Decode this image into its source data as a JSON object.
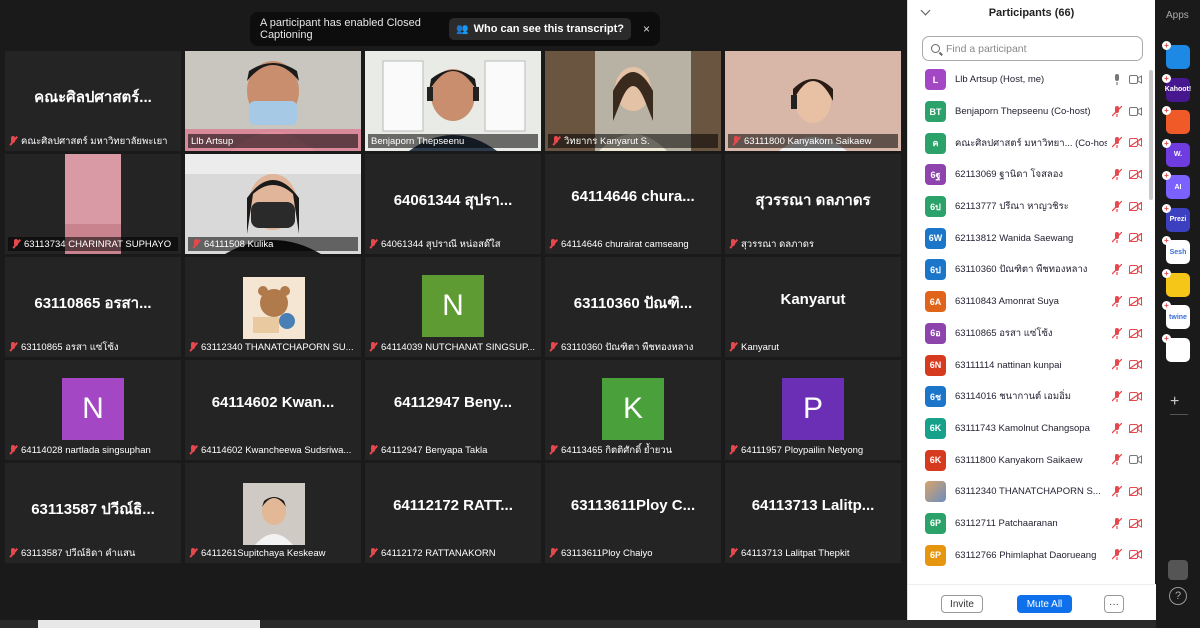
{
  "caption_bar": {
    "message": "A participant has enabled Closed Captioning",
    "button": "Who can see this transcript?",
    "close": "×"
  },
  "tiles": [
    {
      "big": "คณะศิลปศาสตร์...",
      "name": "คณะศิลปศาสตร์ มหาวิทยาลัยพะเยา",
      "mute": true
    },
    {
      "video": "person-mask",
      "name": "Llb Artsup",
      "mute": false,
      "active": true
    },
    {
      "video": "woman-headset",
      "name": "Benjaporn Thepseenu",
      "mute": false
    },
    {
      "video": "woman-library",
      "name": "วิทยากร Kanyarut S.",
      "mute": true
    },
    {
      "video": "girl-headset",
      "name": "63111800 Kanyakorn Saikaew",
      "mute": true
    },
    {
      "video": "pink-hand",
      "name": "63113734 CHARINRAT SUPHAYO",
      "mute": true
    },
    {
      "video": "girl-mask",
      "name": "64111508 Kulika",
      "mute": true
    },
    {
      "big": "64061344 สุปรา...",
      "name": "64061344 สุปราณี หน่อสด๊ใส",
      "mute": true
    },
    {
      "big": "64114646 chura...",
      "name": "64114646 churairat camseang",
      "mute": true
    },
    {
      "big": "สุวรรณา ดลภาดร",
      "name": "สุวรรณา ดลภาดร",
      "mute": true
    },
    {
      "big": "63110865 อรสา...",
      "name": "63110865 อรสา แซ่โซ้ง",
      "mute": true
    },
    {
      "thumb": "bear-photo",
      "name": "63112340 THANATCHAPORN SU...",
      "mute": true
    },
    {
      "letter": "N",
      "letter_color": "#5e9b32",
      "name": "64114039 NUTCHANAT SINGSUP...",
      "mute": true
    },
    {
      "big": "63110360 ปัณฑิ...",
      "name": "63110360 ปัณฑิตา พืชทองหลาง",
      "mute": true
    },
    {
      "big": "Kanyarut",
      "name": "Kanyarut",
      "mute": true
    },
    {
      "letter": "N",
      "letter_color": "#a347c4",
      "name": "64114028 nartlada singsuphan",
      "mute": true
    },
    {
      "big": "64114602 Kwan...",
      "name": "64114602 Kwancheewa Sudsriwa...",
      "mute": true
    },
    {
      "big": "64112947 Beny...",
      "name": "64112947 Benyapa Takla",
      "mute": true
    },
    {
      "letter": "K",
      "letter_color": "#4aa03b",
      "name": "64113465 กิตติศักดิ์ ย้ำยวน",
      "mute": true
    },
    {
      "letter": "P",
      "letter_color": "#6b2fb5",
      "name": "64111957 Ploypailin Netyong",
      "mute": true
    },
    {
      "big": "63113587 ปวีณ์ธิ...",
      "name": "63113587 ปวีณ์ธิดา คำแสน",
      "mute": true
    },
    {
      "thumb": "student-photo",
      "name": "6411261Supitchaya Keskeaw",
      "mute": true
    },
    {
      "big": "64112172 RATT...",
      "name": "64112172 RATTANAKORN",
      "mute": true
    },
    {
      "big": "63113611Ploy C...",
      "name": "63113611Ploy Chaiyo",
      "mute": true
    },
    {
      "big": "64113713 Lalitp...",
      "name": "64113713 Lalitpat Thepkit",
      "mute": true
    }
  ],
  "panel": {
    "title": "Participants (66)",
    "search_placeholder": "Find a participant",
    "participants": [
      {
        "av": "L",
        "color": "#a347c4",
        "name": "Llb Artsup (Host, me)",
        "mic": "on",
        "cam": "on"
      },
      {
        "av": "BT",
        "color": "#2ba26a",
        "name": "Benjaporn Thepseenu (Co-host)",
        "mic": "muted",
        "cam": "on"
      },
      {
        "av": "ค",
        "color": "#2ba26a",
        "name": "คณะศิลปศาสตร์ มหาวิทยา... (Co-host)",
        "mic": "muted",
        "cam": "off"
      },
      {
        "av": "6ฐ",
        "color": "#8e44ad",
        "name": "62113069 ฐานิดา โจสลอง",
        "mic": "muted",
        "cam": "off"
      },
      {
        "av": "6ป",
        "color": "#2ba26a",
        "name": "62113777 ปรีณา หาญวชิระ",
        "mic": "muted",
        "cam": "off"
      },
      {
        "av": "6W",
        "color": "#1b76c9",
        "name": "62113812 Wanida Saewang",
        "mic": "muted",
        "cam": "off"
      },
      {
        "av": "6ป",
        "color": "#1b76c9",
        "name": "63110360 ปัณฑิตา พืชทองหลาง",
        "mic": "muted",
        "cam": "off"
      },
      {
        "av": "6A",
        "color": "#e0651a",
        "name": "63110843 Amonrat Suya",
        "mic": "muted",
        "cam": "off"
      },
      {
        "av": "6อ",
        "color": "#8e44ad",
        "name": "63110865 อรสา แซ่โซ้ง",
        "mic": "muted",
        "cam": "off"
      },
      {
        "av": "6N",
        "color": "#d63b1f",
        "name": "63111114 nattinan kunpai",
        "mic": "muted",
        "cam": "off"
      },
      {
        "av": "6ช",
        "color": "#1b76c9",
        "name": "63114016 ชนากานต์ เอมอิ่ม",
        "mic": "muted",
        "cam": "off"
      },
      {
        "av": "6K",
        "color": "#17a08a",
        "name": "63111743 Kamolnut Changsopa",
        "mic": "muted",
        "cam": "off"
      },
      {
        "av": "6K",
        "color": "#d63b1f",
        "name": "63111800 Kanyakorn Saikaew",
        "mic": "muted",
        "cam": "on"
      },
      {
        "av": "",
        "color": "#c98b4a",
        "name": "63112340 THANATCHAPORN S...",
        "mic": "muted",
        "cam": "off"
      },
      {
        "av": "6P",
        "color": "#2ba26a",
        "name": "63112711 Patchaaranan",
        "mic": "muted",
        "cam": "off"
      },
      {
        "av": "6P",
        "color": "#e6950f",
        "name": "63112766 Phimlaphat Daorueang",
        "mic": "muted",
        "cam": "off"
      }
    ],
    "invite": "Invite",
    "mute_all": "Mute All",
    "more": "···"
  },
  "rail": {
    "title": "Apps",
    "apps": [
      {
        "label": "",
        "color": "#1e88e5"
      },
      {
        "label": "Kahoot!",
        "color": "#46178f"
      },
      {
        "label": "",
        "color": "#ef5a28"
      },
      {
        "label": "W.",
        "color": "#6f3ce0"
      },
      {
        "label": "AI",
        "color": "#7b61ff"
      },
      {
        "label": "Prezi",
        "color": "#3b3fc0"
      },
      {
        "label": "Sesh",
        "color": "#ffffff"
      },
      {
        "label": "",
        "color": "#f5c518"
      },
      {
        "label": "twine",
        "color": "#ffffff"
      },
      {
        "label": "",
        "color": "#ffffff"
      }
    ],
    "help": "?"
  }
}
